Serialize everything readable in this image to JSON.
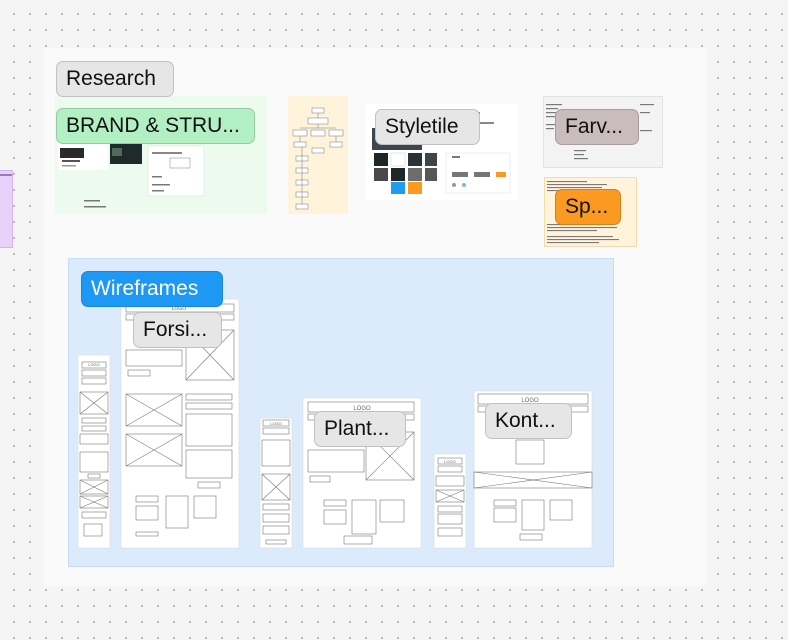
{
  "canvas": {
    "background": "#f5f5f5",
    "board_color": "#fafafa"
  },
  "sections": {
    "research_label": "Research",
    "brand_label": "BRAND & STRU...",
    "styletile_label": "Styletile",
    "farv_label": "Farv...",
    "sp_label": "Sp...",
    "wireframes_label": "Wireframes",
    "forsi_label": "Forsi...",
    "plant_label": "Plant...",
    "kont_label": "Kont..."
  },
  "wireframes": {
    "logo_text": "LOGO"
  },
  "colors": {
    "research_tag": "#e6e6e6",
    "brand_tag": "#b2f0c4",
    "styletile_tag": "#e6e6e6",
    "farv_tag": "#c8bcbc",
    "sp_tag": "#fb9a23",
    "wireframes_tag": "#1e98f5",
    "wireframes_section": "#dcebfc"
  }
}
